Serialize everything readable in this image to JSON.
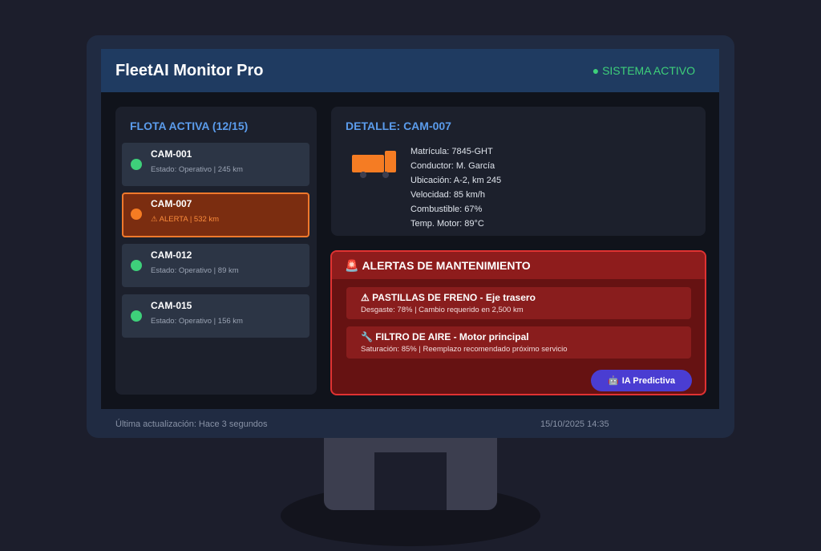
{
  "app": {
    "title": "FleetAI Monitor Pro",
    "status": "● SISTEMA ACTIVO"
  },
  "fleet": {
    "title": "FLOTA ACTIVA (12/15)",
    "trucks": [
      {
        "id": "CAM-001",
        "status": "Estado: Operativo | 245 km",
        "color": "#3ed07a"
      },
      {
        "id": "CAM-007",
        "status": "⚠ ALERTA | 532 km",
        "color": "#f57c23"
      },
      {
        "id": "CAM-012",
        "status": "Estado: Operativo | 89 km",
        "color": "#3ed07a"
      },
      {
        "id": "CAM-015",
        "status": "Estado: Operativo | 156 km",
        "color": "#3ed07a"
      }
    ]
  },
  "detail": {
    "title": "DETALLE: CAM-007",
    "icon": "truck-icon",
    "lines": [
      "Matrícula: 7845-GHT",
      "Conductor: M. García",
      "Ubicación: A-2, km 245",
      "Velocidad: 85 km/h",
      "Combustible: 67%",
      "Temp. Motor: 89°C"
    ]
  },
  "alerts": {
    "icon": "🚨",
    "title": "ALERTAS DE MANTENIMIENTO",
    "items": [
      {
        "title": "⚠ PASTILLAS DE FRENO - Eje trasero",
        "desc": "Desgaste: 78% | Cambio requerido en 2,500 km"
      },
      {
        "title": "🔧 FILTRO DE AIRE - Motor principal",
        "desc": "Saturación: 85% | Reemplazo recomendado próximo servicio"
      }
    ],
    "ai_button_icon": "🤖",
    "ai_button": "IA Predictiva"
  },
  "footer": {
    "updated": "Última actualización: Hace 3 segundos",
    "datetime": "15/10/2025 14:35"
  },
  "colors": {
    "accent": "#5b9cec",
    "ok": "#3ed07a",
    "warning": "#f57c23",
    "danger": "#e03232",
    "ai": "#4a3dd2"
  }
}
